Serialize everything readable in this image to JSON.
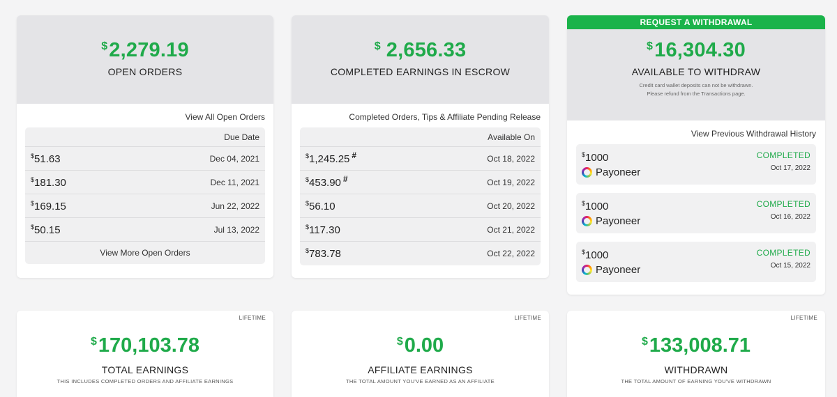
{
  "open_orders": {
    "currency": "$",
    "amount": "2,279.19",
    "label": "OPEN ORDERS",
    "view_all": "View All Open Orders",
    "column_header": "Due Date",
    "rows": [
      {
        "currency": "$",
        "amount": "51.63",
        "date": "Dec 04, 2021"
      },
      {
        "currency": "$",
        "amount": "181.30",
        "date": "Dec 11, 2021"
      },
      {
        "currency": "$",
        "amount": "169.15",
        "date": "Jun 22, 2022"
      },
      {
        "currency": "$",
        "amount": "50.15",
        "date": "Jul 13, 2022"
      }
    ],
    "view_more": "View More Open Orders"
  },
  "escrow": {
    "currency": "$",
    "amount": "2,656.33",
    "label": "COMPLETED EARNINGS IN ESCROW",
    "sublink": "Completed Orders, Tips & Affiliate Pending Release",
    "column_header": "Available On",
    "rows": [
      {
        "currency": "$",
        "amount": "1,245.25",
        "mark": "#",
        "date": "Oct 18, 2022"
      },
      {
        "currency": "$",
        "amount": "453.90",
        "mark": "#",
        "date": "Oct 19, 2022"
      },
      {
        "currency": "$",
        "amount": "56.10",
        "mark": "",
        "date": "Oct 20, 2022"
      },
      {
        "currency": "$",
        "amount": "117.30",
        "mark": "",
        "date": "Oct 21, 2022"
      },
      {
        "currency": "$",
        "amount": "783.78",
        "mark": "",
        "date": "Oct 22, 2022"
      }
    ]
  },
  "withdraw": {
    "request_label": "REQUEST A WITHDRAWAL",
    "currency": "$",
    "amount": "16,304.30",
    "label": "AVAILABLE TO WITHDRAW",
    "note_line1": "Credit card wallet deposits can not be withdrawn.",
    "note_line2": "Please refund from the Transactions page.",
    "history_link": "View Previous Withdrawal History",
    "items": [
      {
        "currency": "$",
        "amount": "1000",
        "method": "Payoneer",
        "status": "COMPLETED",
        "date": "Oct 17, 2022"
      },
      {
        "currency": "$",
        "amount": "1000",
        "method": "Payoneer",
        "status": "COMPLETED",
        "date": "Oct 16, 2022"
      },
      {
        "currency": "$",
        "amount": "1000",
        "method": "Payoneer",
        "status": "COMPLETED",
        "date": "Oct 15, 2022"
      }
    ]
  },
  "totals": [
    {
      "tag": "LIFETIME",
      "currency": "$",
      "amount": "170,103.78",
      "label": "TOTAL EARNINGS",
      "note": "THIS INCLUDES COMPLETED ORDERS AND AFFILIATE EARNINGS"
    },
    {
      "tag": "LIFETIME",
      "currency": "$",
      "amount": "0.00",
      "label": "AFFILIATE EARNINGS",
      "note": "THE TOTAL AMOUNT YOU'VE EARNED AS AN AFFILIATE"
    },
    {
      "tag": "LIFETIME",
      "currency": "$",
      "amount": "133,008.71",
      "label": "WITHDRAWN",
      "note": "THE TOTAL AMOUNT OF EARNING YOU'VE WITHDRAWN"
    }
  ],
  "colors": {
    "accent_green": "#1faa4a",
    "header_gray": "#e4e4e7",
    "button_green": "#1ab34a"
  }
}
